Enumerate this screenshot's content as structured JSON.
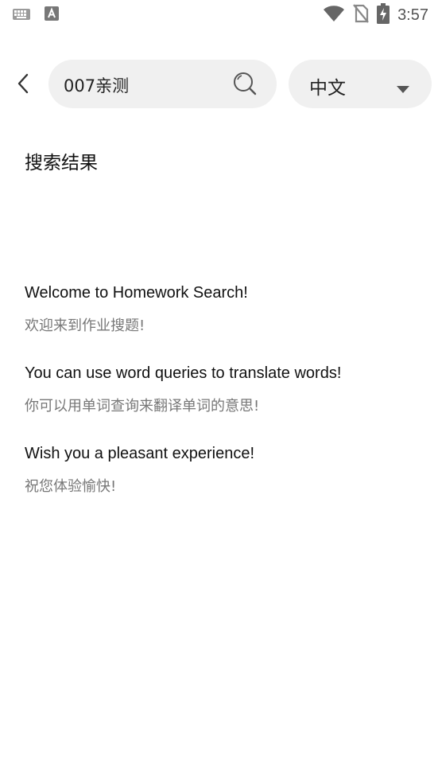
{
  "status_bar": {
    "time": "3:57",
    "icons": [
      "keyboard-icon",
      "font-a-icon",
      "wifi-icon",
      "no-sim-icon",
      "battery-charging-icon"
    ]
  },
  "header": {
    "back_icon": "chevron-left-icon",
    "search": {
      "value": "007亲测",
      "icon": "search-icon"
    },
    "language": {
      "selected": "中文",
      "icon": "caret-down-icon"
    }
  },
  "main": {
    "section_title": "搜索结果",
    "messages": [
      {
        "en": "Welcome to Homework Search!",
        "zh": "欢迎来到作业搜题!"
      },
      {
        "en": "You can use word queries to translate words!",
        "zh": "你可以用单词查询来翻译单词的意思!"
      },
      {
        "en": "Wish you a pleasant experience!",
        "zh": "祝您体验愉快!"
      }
    ]
  }
}
